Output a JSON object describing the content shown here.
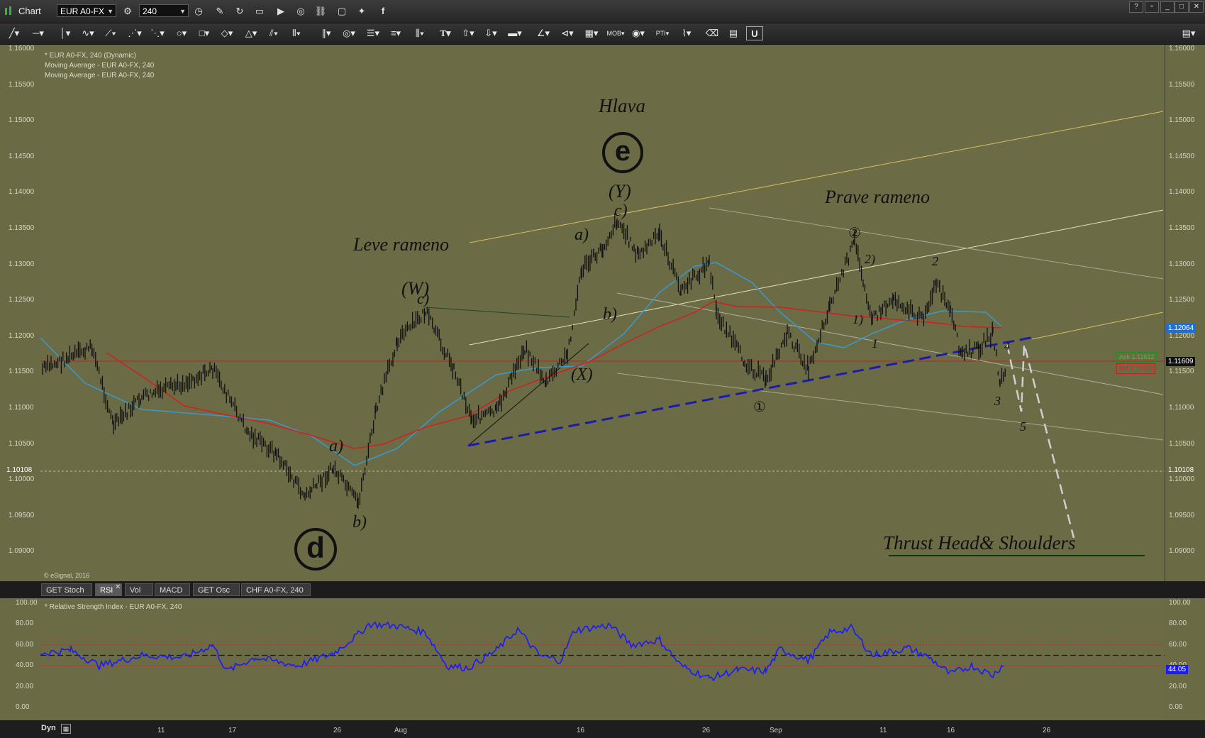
{
  "app": {
    "title": "Chart"
  },
  "toolbar": {
    "symbol": "EUR A0-FX",
    "interval": "240",
    "icons": [
      "cursor-icon",
      "link-icon",
      "pencil-icon",
      "refresh-icon",
      "tag-icon",
      "play-icon",
      "globe-icon",
      "chain-icon",
      "comment-icon",
      "twitter-icon",
      "facebook-icon"
    ]
  },
  "drawing_tools": [
    "line",
    "horizontal-line",
    "vertical-line",
    "freehand",
    "fib-retracement",
    "fib-fan",
    "gann-fan",
    "ellipse",
    "rectangle",
    "eraser",
    "triangle",
    "pitchfork",
    "cycle-lines",
    "parallel-lines",
    "circle",
    "fib-levels",
    "fib-time",
    "vertical-lines",
    "text",
    "arrow-up",
    "arrow-down",
    "bar",
    "angle",
    "ray",
    "grid",
    "mob",
    "eye",
    "pti",
    "wave",
    "erase-all",
    "comment",
    "magnet"
  ],
  "legend": [
    "* EUR A0-FX, 240 (Dynamic)",
    "Moving Average - EUR A0-FX, 240",
    "Moving Average - EUR A0-FX, 240"
  ],
  "copyright": "© eSignal, 2016",
  "price_axis": [
    "1.16000",
    "1.15500",
    "1.15000",
    "1.14500",
    "1.14000",
    "1.13500",
    "1.13000",
    "1.12500",
    "1.12000",
    "1.11500",
    "1.11000",
    "1.10500",
    "1.10000",
    "1.09500",
    "1.09000"
  ],
  "price_tags": {
    "left_marker": "1.10108",
    "right_marker": "1.10108",
    "ma_value": "1.12064",
    "last": "1.11609",
    "ask": "Ask 1.11612",
    "bid": "Bid 1.11609"
  },
  "annotations": {
    "hlava": "Hlava",
    "wave_e": "e",
    "wave_d": "d",
    "leve_rameno": "Leve rameno",
    "prave_rameno": "Prave rameno",
    "thrust": "Thrust Head& Shoulders",
    "Y": "(Y)",
    "W": "(W)",
    "X": "(X)",
    "c_top": "c)",
    "c_w": "c)",
    "a_top": "a)",
    "b_top": "b)",
    "a_low": "a)",
    "b_low": "b)",
    "circle1": "①",
    "circle2": "②",
    "one_a": "1)",
    "two_a": "2)",
    "one": "1",
    "two": "2",
    "three": "3",
    "four": "4",
    "five": "5"
  },
  "subtabs": [
    "GET Stoch",
    "RSI",
    "Vol",
    "MACD",
    "GET Osc",
    "CHF A0-FX, 240"
  ],
  "rsi": {
    "legend": "* Relative Strength Index - EUR A0-FX, 240",
    "axis": [
      "100.00",
      "80.00",
      "60.00",
      "40.00",
      "20.00",
      "0.00"
    ],
    "value": "44.05"
  },
  "x_axis": {
    "mode": "Dyn",
    "labels": [
      "11",
      "17",
      "26",
      "Aug",
      "16",
      "26",
      "Sep",
      "11",
      "16",
      "26"
    ]
  },
  "colors": {
    "panel": "#6b6b46",
    "rsi_line": "#1a1aff",
    "trend_dashed": "#1c1ca8",
    "ma_blue": "#3a9ad0",
    "ma_red": "#d02020",
    "channel_yellow": "#d8c060"
  }
}
